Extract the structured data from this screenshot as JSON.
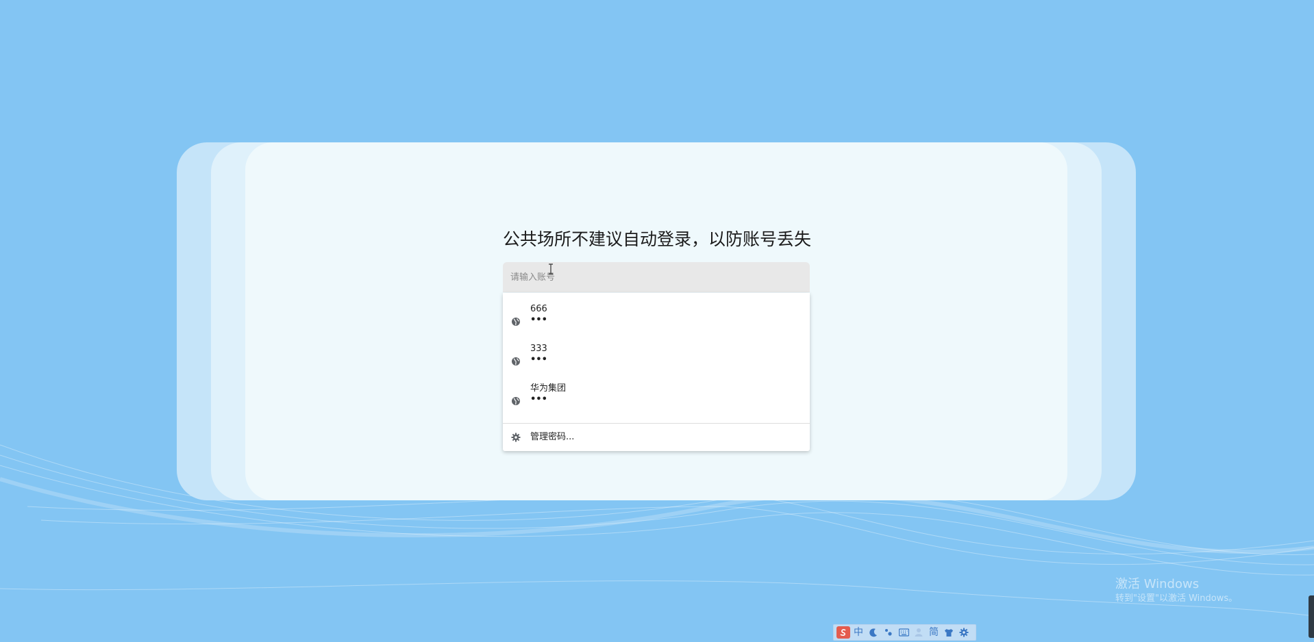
{
  "colors": {
    "background": "#83c5f3",
    "card_outer": "#c5e4f9",
    "card_middle": "#dff1fb",
    "card_inner": "#eff9fc",
    "input_bg": "#e8e8e8",
    "ime_accent": "#3b78c4"
  },
  "login": {
    "notice": "公共场所不建议自动登录，以防账号丢失",
    "account_placeholder": "请输入账号",
    "account_value": ""
  },
  "autofill": {
    "item_icon": "globe-icon",
    "items": [
      {
        "account": "666",
        "password_mask": "•••"
      },
      {
        "account": "333",
        "password_mask": "•••"
      },
      {
        "account": "华为集团",
        "password_mask": "•••"
      }
    ],
    "manage_icon": "gear-icon",
    "manage_label": "管理密码..."
  },
  "watermark": {
    "title": "激活 Windows",
    "subtitle": "转到\"设置\"以激活 Windows。"
  },
  "ime_toolbar": {
    "mode_label": "中",
    "charset_label": "简",
    "icons": [
      "sogou-logo-icon",
      "moon-icon",
      "punctuation-icon",
      "keyboard-icon",
      "user-icon",
      "skin-icon",
      "settings-icon"
    ]
  }
}
